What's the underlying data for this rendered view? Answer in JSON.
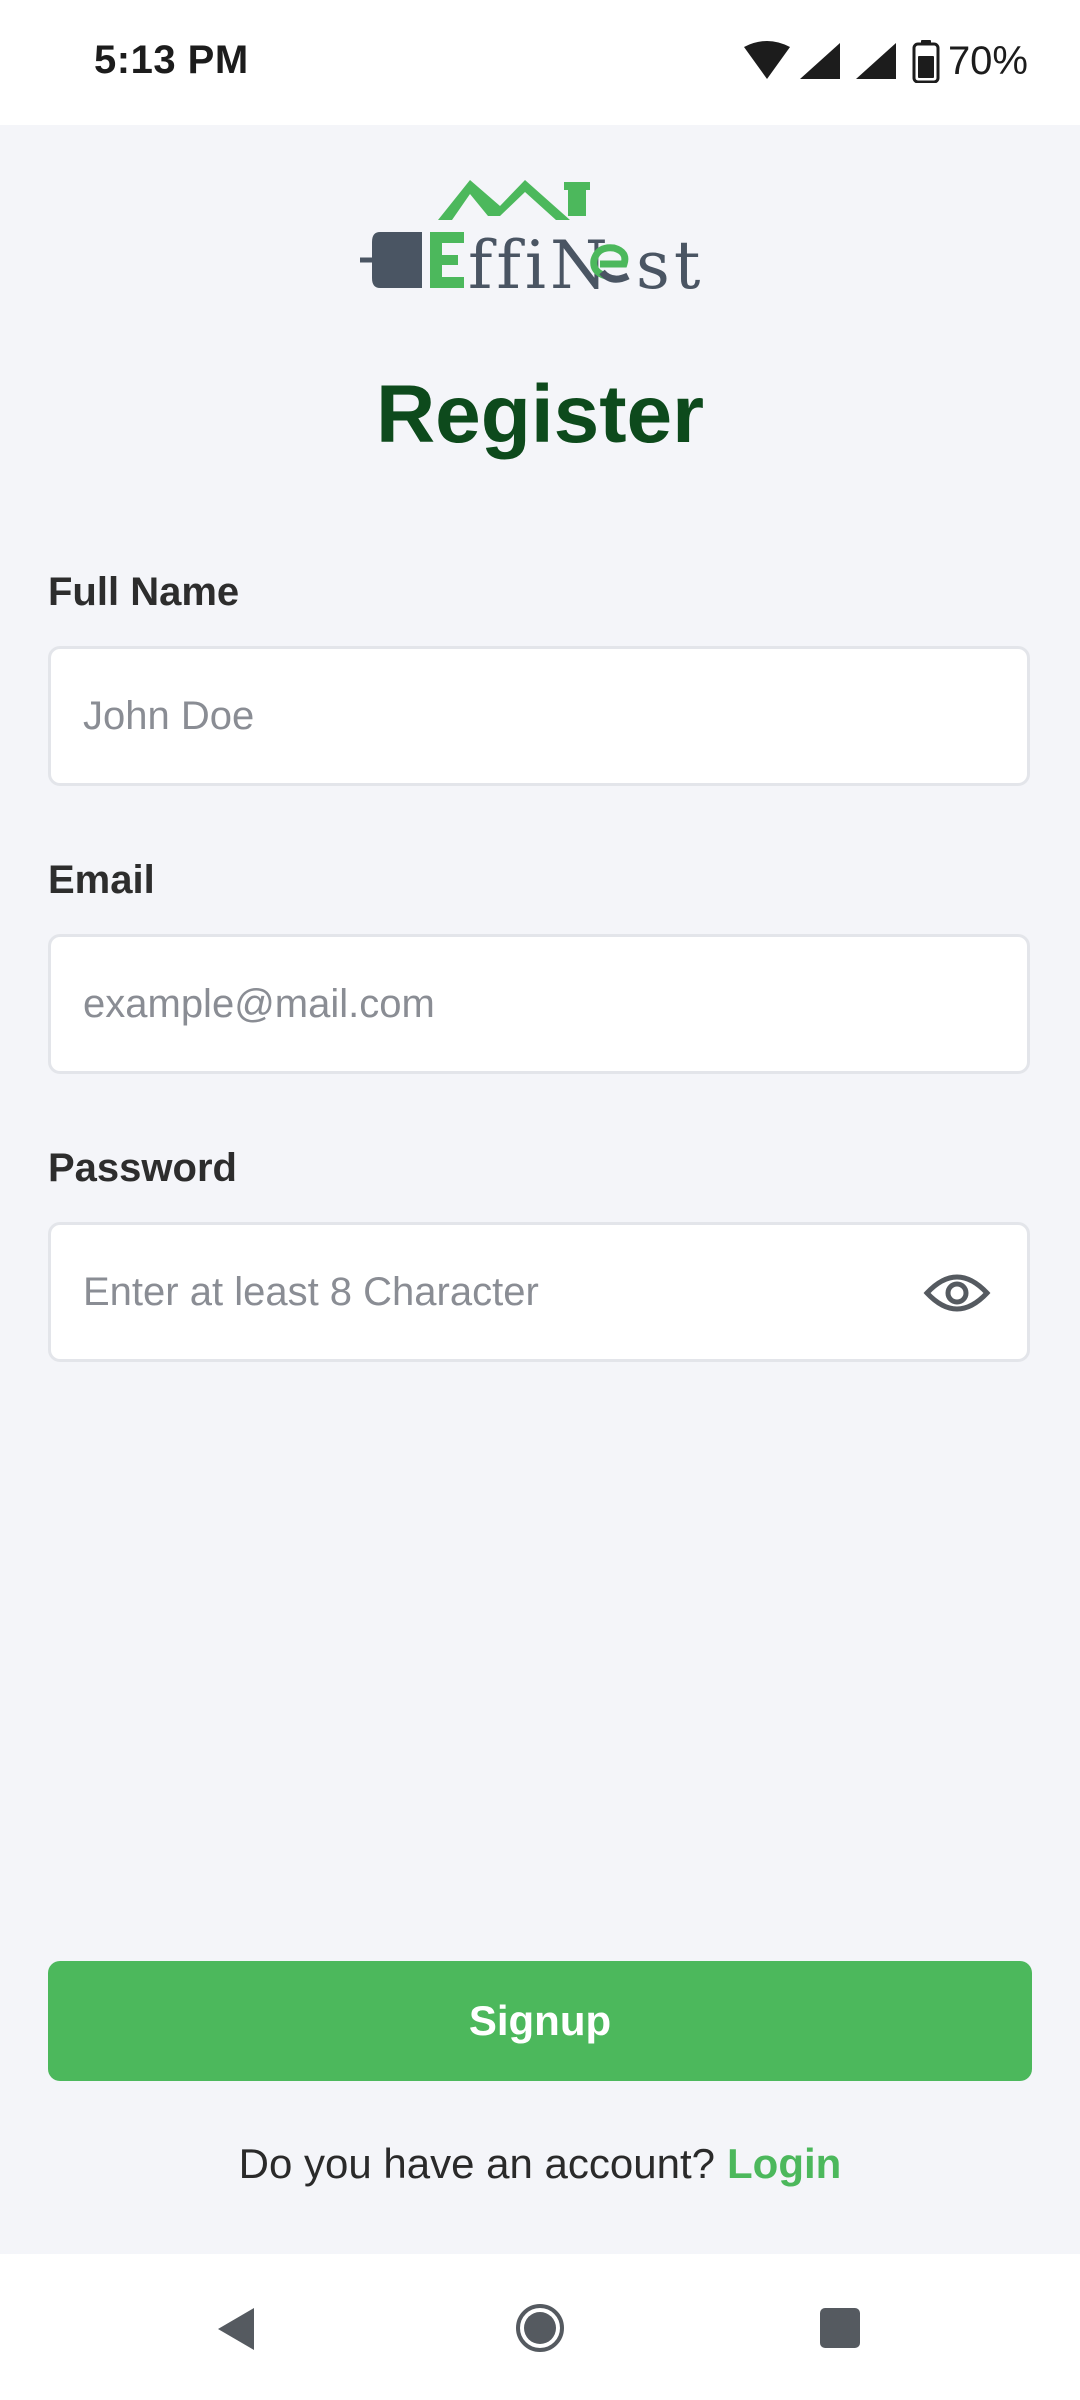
{
  "status_bar": {
    "time": "5:13 PM",
    "battery_percent": "70%",
    "icons": [
      "wifi-icon",
      "cell-signal-icon",
      "cell-signal-icon",
      "battery-icon"
    ]
  },
  "logo": {
    "text": "EffiNest",
    "colors": {
      "green": "#4cb85c",
      "slate": "#4a5563"
    }
  },
  "page": {
    "title": "Register"
  },
  "form": {
    "full_name": {
      "label": "Full Name",
      "placeholder": "John Doe",
      "value": ""
    },
    "email": {
      "label": "Email",
      "placeholder": "example@mail.com",
      "value": ""
    },
    "password": {
      "label": "Password",
      "placeholder": "Enter at least 8 Character",
      "value": "",
      "toggle_icon": "eye-icon"
    }
  },
  "actions": {
    "signup_label": "Signup",
    "account_prompt": "Do you have an account?",
    "login_label": "Login"
  },
  "nav_bar": {
    "icons": [
      "back-icon",
      "home-icon",
      "recents-icon"
    ]
  },
  "colors": {
    "accent": "#4cb85c",
    "title": "#0d4a1c",
    "background": "#f4f5f9"
  }
}
